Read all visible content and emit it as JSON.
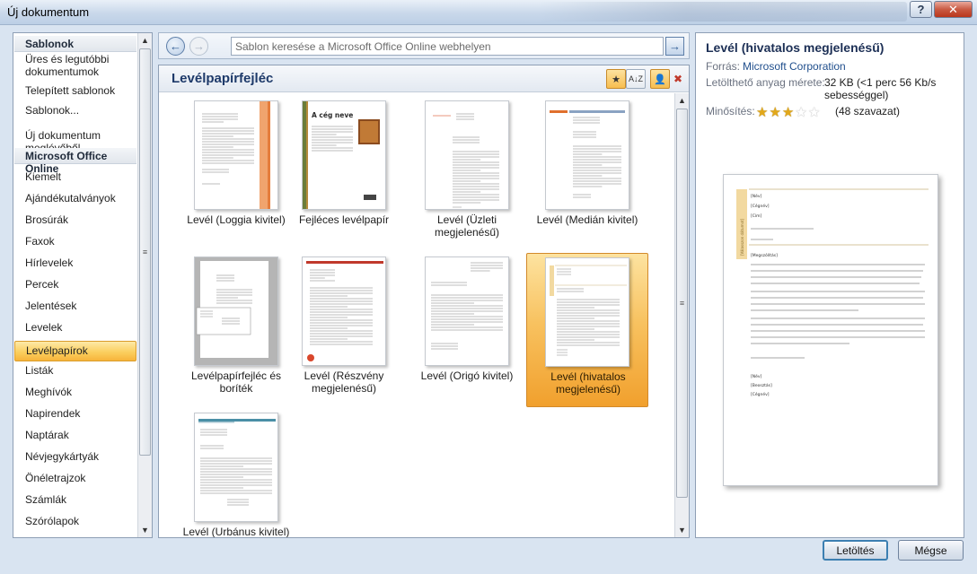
{
  "window": {
    "title": "Új dokumentum",
    "help_label": "?",
    "close_label": "✕"
  },
  "sidebar": {
    "items": [
      {
        "kind": "header",
        "label": "Sablonok"
      },
      {
        "kind": "item",
        "label": "Üres és legutóbbi dokumentumok"
      },
      {
        "kind": "item",
        "label": "Telepített sablonok"
      },
      {
        "kind": "item",
        "label": "Sablonok..."
      },
      {
        "kind": "item",
        "label": "Új dokumentum meglévőből..."
      },
      {
        "kind": "header",
        "label": "Microsoft Office Online"
      },
      {
        "kind": "item",
        "label": "Kiemelt"
      },
      {
        "kind": "item",
        "label": "Ajándékutalványok"
      },
      {
        "kind": "item",
        "label": "Brosúrák"
      },
      {
        "kind": "item",
        "label": "Faxok"
      },
      {
        "kind": "item",
        "label": "Hírlevelek"
      },
      {
        "kind": "item",
        "label": "Percek"
      },
      {
        "kind": "item",
        "label": "Jelentések"
      },
      {
        "kind": "item",
        "label": "Levelek"
      },
      {
        "kind": "item",
        "label": "Levélpapírok",
        "selected": true
      },
      {
        "kind": "item",
        "label": "Listák"
      },
      {
        "kind": "item",
        "label": "Meghívók"
      },
      {
        "kind": "item",
        "label": "Napirendek"
      },
      {
        "kind": "item",
        "label": "Naptárak"
      },
      {
        "kind": "item",
        "label": "Névjegykártyák"
      },
      {
        "kind": "item",
        "label": "Önéletrajzok"
      },
      {
        "kind": "item",
        "label": "Számlák"
      },
      {
        "kind": "item",
        "label": "Szórólapok"
      }
    ]
  },
  "search": {
    "placeholder": "Sablon keresése a Microsoft Office Online webhelyen",
    "back_label": "←",
    "forward_label": "→",
    "go_label": "→"
  },
  "gallery": {
    "title": "Levélpapírfejléc",
    "toolbar": {
      "sort_rating_label": "★",
      "sort_az_label": "A↓Z",
      "user_label": "👤",
      "remove_label": "👤"
    },
    "templates": [
      {
        "label": "Levél (Loggia kivitel)",
        "style": "loggia"
      },
      {
        "label": "Fejléces levélpapír",
        "style": "cegneve",
        "thumb_heading": "A cég neve"
      },
      {
        "label": "Levél (Üzleti megjelenésű)",
        "style": "uzleti"
      },
      {
        "label": "Levél (Medián kivitel)",
        "style": "median"
      },
      {
        "label": "Levélpapírfejléc és boríték",
        "style": "boritek"
      },
      {
        "label": "Levél (Részvény megjelenésű)",
        "style": "reszveny"
      },
      {
        "label": "Levél (Origó kivitel)",
        "style": "origo"
      },
      {
        "label": "Levél (hivatalos megjelenésű)",
        "style": "hivatalos",
        "selected": true
      },
      {
        "label": "Levél (Urbánus kivitel)",
        "style": "urbanus"
      }
    ]
  },
  "details": {
    "title": "Levél (hivatalos megjelenésű)",
    "source_label": "Forrás:",
    "source_value": "Microsoft Corporation",
    "size_label": "Letölthető anyag mérete:",
    "size_value": "32 KB (<1 perc 56 Kb/s sebességgel)",
    "rating_label": "Minősítés:",
    "rating": 3,
    "rating_max": 5,
    "votes": "(48 szavazat)"
  },
  "preview": {
    "placeholders": [
      "[Név]",
      "[Cégnév]",
      "[Cím]",
      "[Megszólítás]",
      "[Név]",
      "[Beosztás]",
      "[Cégnév]"
    ],
    "side_label": "[Válasszon dátumot]"
  },
  "buttons": {
    "download": "Letöltés",
    "cancel": "Mégse"
  },
  "colors": {
    "accent_orange": "#f7b43b",
    "title_blue": "#1c2f55"
  }
}
